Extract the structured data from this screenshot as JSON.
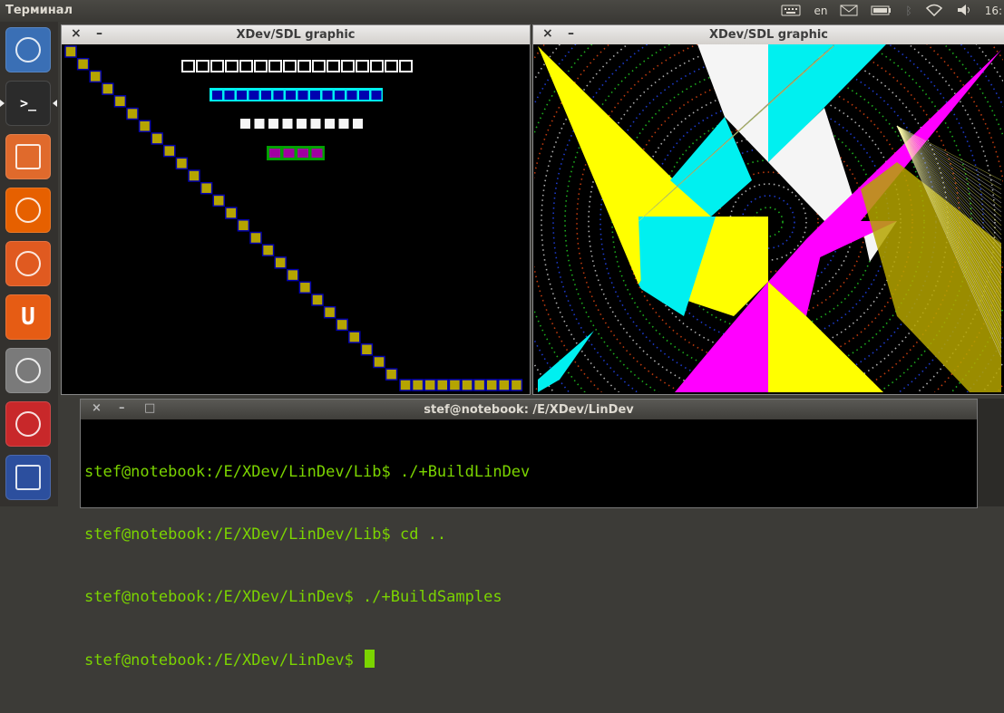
{
  "topbar": {
    "title": "Терминал",
    "language": "en",
    "clock": "16:"
  },
  "launcher": {
    "items": [
      {
        "name": "dash-home",
        "icon": "ubuntu-logo-icon",
        "color": "#3a6fb5"
      },
      {
        "name": "terminal",
        "icon": "terminal-icon",
        "color": "#2b2b2b",
        "glyph": ">_"
      },
      {
        "name": "files",
        "icon": "folder-icon",
        "color": "#e06a2c"
      },
      {
        "name": "firefox",
        "icon": "firefox-icon",
        "color": "#e66000"
      },
      {
        "name": "software-center",
        "icon": "shopping-bag-icon",
        "color": "#e05a20"
      },
      {
        "name": "ubuntu-one",
        "icon": "ubuntu-one-icon",
        "color": "#e65c14",
        "glyph": "U"
      },
      {
        "name": "system-settings",
        "icon": "settings-icon",
        "color": "#7a7a7a"
      },
      {
        "name": "sound-recorder",
        "icon": "microphone-icon",
        "color": "#c8282a"
      },
      {
        "name": "text-editor",
        "icon": "save-icon",
        "color": "#2c4f9e"
      }
    ]
  },
  "windows": {
    "left": {
      "title": "XDev/SDL graphic",
      "close": "×",
      "minimize": "–"
    },
    "right": {
      "title": "XDev/SDL graphic",
      "close": "×",
      "minimize": "–"
    }
  },
  "terminal": {
    "title": "stef@notebook: /E/XDev/LinDev",
    "close": "×",
    "minimize": "–",
    "maximize": "□",
    "lines": [
      "stef@notebook:/E/XDev/LinDev/Lib$ ./+BuildLinDev",
      "stef@notebook:/E/XDev/LinDev/Lib$ cd ..",
      "stef@notebook:/E/XDev/LinDev$ ./+BuildSamples",
      "stef@notebook:/E/XDev/LinDev$ "
    ]
  },
  "colors": {
    "olive": "#b5a400",
    "blue": "#0000b0",
    "cyan": "#00f0f0",
    "yellow": "#ffff00",
    "magenta": "#ff00ff",
    "white": "#f5f5f5",
    "purple": "#a000a0",
    "green": "#00a000",
    "terminal_text": "#7bd400"
  }
}
